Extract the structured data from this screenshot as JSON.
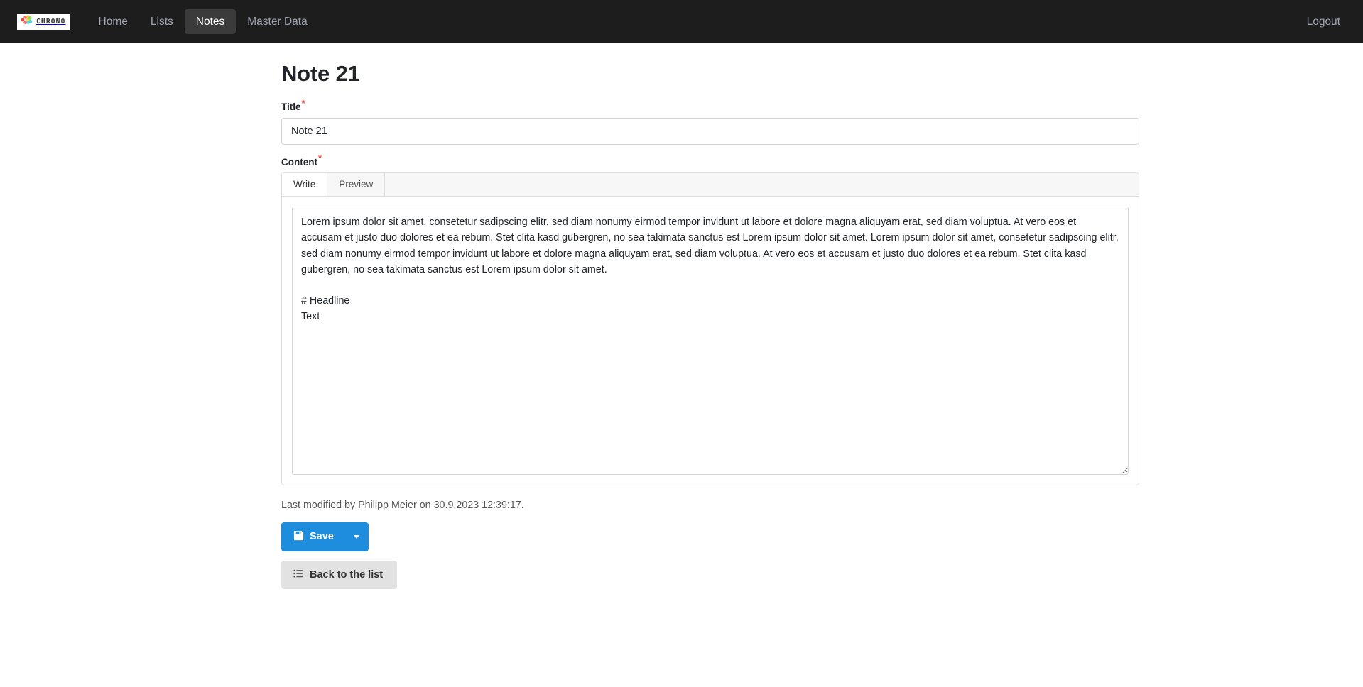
{
  "navbar": {
    "brand": {
      "name": "CHRONO",
      "icon": "chrono-logo-icon"
    },
    "links": [
      {
        "label": "Home",
        "active": false
      },
      {
        "label": "Lists",
        "active": false
      },
      {
        "label": "Notes",
        "active": true
      },
      {
        "label": "Master Data",
        "active": false
      }
    ],
    "logout_label": "Logout"
  },
  "page": {
    "title": "Note 21"
  },
  "form": {
    "title_field": {
      "label": "Content",
      "label_text": "Title",
      "required_marker": "*",
      "value": "Note 21",
      "placeholder": ""
    },
    "content_field": {
      "label_text": "Content",
      "required_marker": "*",
      "tabs": [
        {
          "label": "Write",
          "active": true
        },
        {
          "label": "Preview",
          "active": false
        }
      ],
      "value": "Lorem ipsum dolor sit amet, consetetur sadipscing elitr, sed diam nonumy eirmod tempor invidunt ut labore et dolore magna aliquyam erat, sed diam voluptua. At vero eos et accusam et justo duo dolores et ea rebum. Stet clita kasd gubergren, no sea takimata sanctus est Lorem ipsum dolor sit amet. Lorem ipsum dolor sit amet, consetetur sadipscing elitr, sed diam nonumy eirmod tempor invidunt ut labore et dolore magna aliquyam erat, sed diam voluptua. At vero eos et accusam et justo duo dolores et ea rebum. Stet clita kasd gubergren, no sea takimata sanctus est Lorem ipsum dolor sit amet.\n\n# Headline\nText",
      "placeholder": ""
    }
  },
  "meta": {
    "last_modified": "Last modified by Philipp Meier on 30.9.2023 12:39:17."
  },
  "actions": {
    "save_label": "Save",
    "save_icon": "save-floppy-icon",
    "save_dropdown_icon": "caret-down-icon",
    "back_label": "Back to the list",
    "back_icon": "list-icon"
  },
  "colors": {
    "navbar_bg": "#1d1d1d",
    "primary": "#1e8ddd",
    "secondary": "#e2e2e2",
    "required": "#e74c3c"
  }
}
